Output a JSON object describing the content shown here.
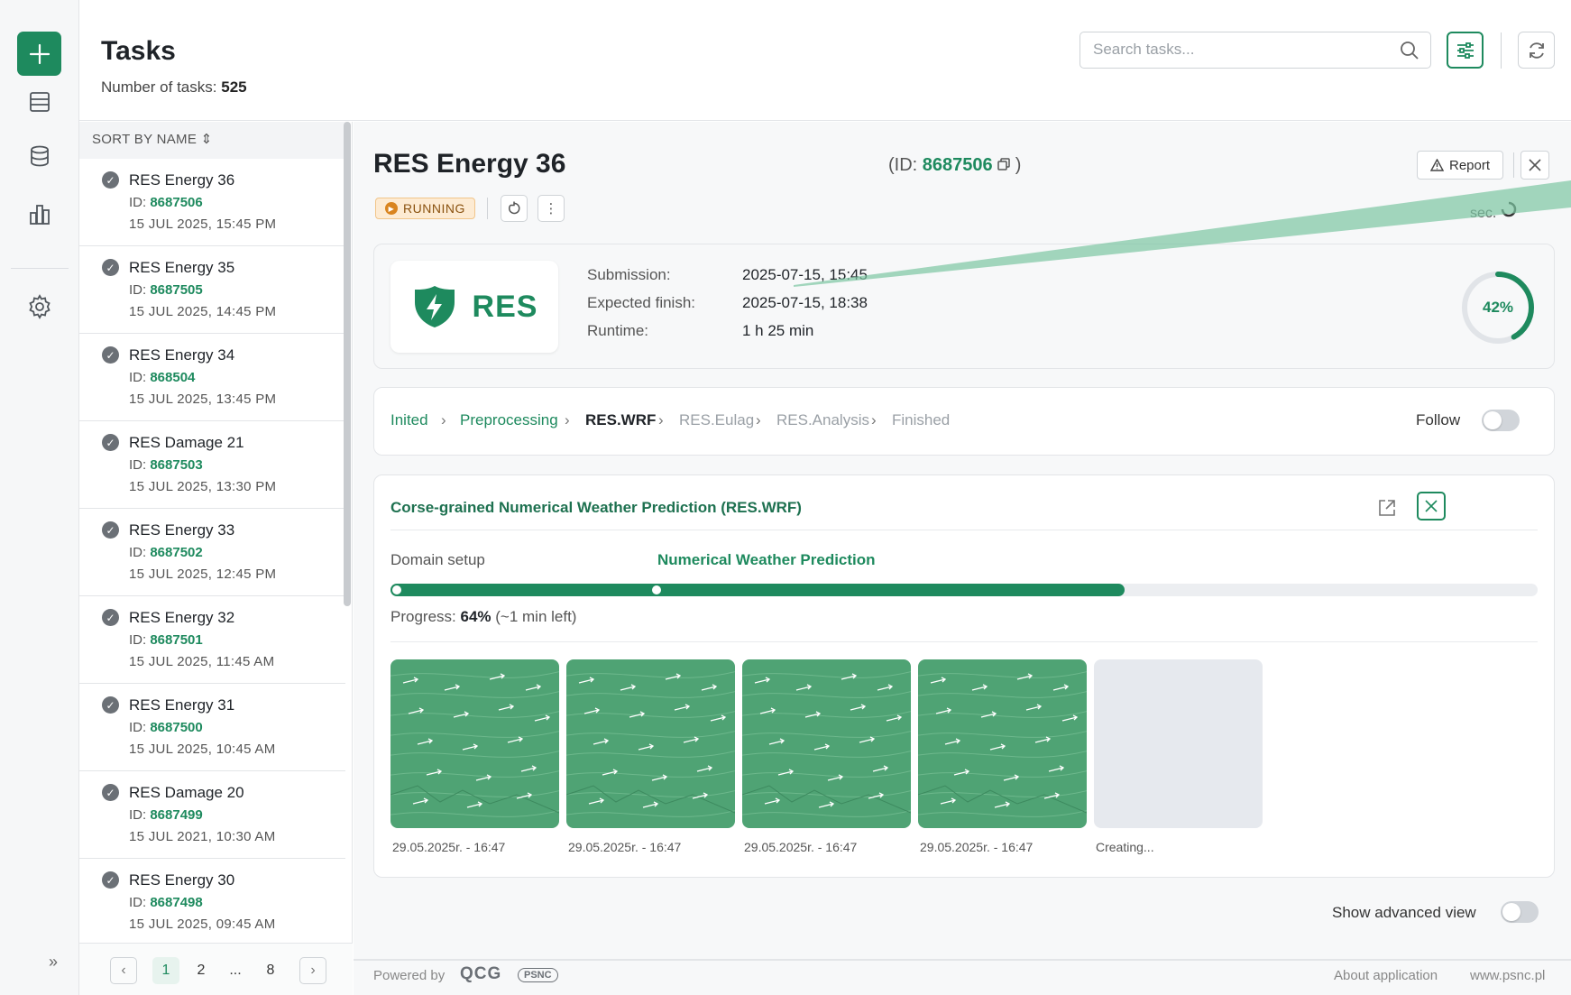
{
  "header": {
    "title": "Tasks",
    "count_label": "Number of tasks:",
    "count_value": "525",
    "search_placeholder": "Search tasks..."
  },
  "sidebar": {
    "icons": [
      "plus-icon",
      "list-icon",
      "database-icon",
      "chart-icon",
      "gear-icon"
    ],
    "collapse": "»"
  },
  "list": {
    "sort_label": "SORT BY NAME",
    "sort_icon": "⇕",
    "id_prefix": "ID:",
    "tasks": [
      {
        "name": "RES Energy 36",
        "id": "8687506",
        "date": "15 JUL 2025, 15:45 PM"
      },
      {
        "name": "RES Energy 35",
        "id": "8687505",
        "date": "15 JUL 2025, 14:45 PM"
      },
      {
        "name": "RES Energy 34",
        "id": "868504",
        "date": "15 JUL 2025, 13:45 PM"
      },
      {
        "name": "RES Damage 21",
        "id": "8687503",
        "date": "15 JUL 2025, 13:30 PM"
      },
      {
        "name": "RES Energy 33",
        "id": "8687502",
        "date": "15 JUL 2025, 12:45 PM"
      },
      {
        "name": "RES Energy 32",
        "id": "8687501",
        "date": "15 JUL 2025, 11:45 AM"
      },
      {
        "name": "RES Energy 31",
        "id": "8687500",
        "date": "15 JUL 2025, 10:45 AM"
      },
      {
        "name": "RES Damage 20",
        "id": "8687499",
        "date": "15 JUL 2021, 10:30 AM"
      },
      {
        "name": "RES Energy 30",
        "id": "8687498",
        "date": "15 JUL 2025, 09:45 AM"
      }
    ],
    "pager": {
      "prev": "‹",
      "pages": [
        "1",
        "2",
        "...",
        "8"
      ],
      "next": "›",
      "active": "1"
    }
  },
  "detail": {
    "title": "RES Energy  36",
    "id_open": "(ID:",
    "id_value": "8687506",
    "id_close": ")",
    "status": "RUNNING",
    "report_label": "Report",
    "partial_text": "sec.",
    "logo_text": "RES",
    "info": [
      {
        "label": "Submission:",
        "value": "2025-07-15, 15:45"
      },
      {
        "label": "Expected finish:",
        "value": "2025-07-15, 18:38"
      },
      {
        "label": "Runtime:",
        "value": "1 h 25 min"
      }
    ],
    "overall_progress": 42,
    "overall_progress_label": "42%",
    "steps": [
      {
        "label": "Inited",
        "state": "done"
      },
      {
        "label": "Preprocessing",
        "state": "done"
      },
      {
        "label": "RES.WRF",
        "state": "current"
      },
      {
        "label": "RES.Eulag",
        "state": "todo"
      },
      {
        "label": "RES.Analysis",
        "state": "todo"
      },
      {
        "label": "Finished",
        "state": "todo"
      }
    ],
    "follow_label": "Follow",
    "follow_on": false,
    "stage": {
      "title": "Corse-grained Numerical Weather Prediction (RES.WRF)",
      "phase_1": "Domain setup",
      "phase_2": "Numerical Weather Prediction",
      "progress": 64,
      "progress_label": "Progress:",
      "progress_value": "64%",
      "progress_left": "(~1 min left)",
      "thumbnails": [
        {
          "label": "29.05.2025r. - 16:47",
          "state": "ready"
        },
        {
          "label": "29.05.2025r. - 16:47",
          "state": "ready"
        },
        {
          "label": "29.05.2025r. - 16:47",
          "state": "ready"
        },
        {
          "label": "29.05.2025r. - 16:47",
          "state": "ready"
        },
        {
          "label": "Creating...",
          "state": "pending"
        }
      ]
    },
    "advanced_label": "Show advanced view",
    "advanced_on": false
  },
  "footer": {
    "powered": "Powered by",
    "qcg": "QCG",
    "psnc": "PSNC",
    "about": "About application",
    "www": "www.psnc.pl"
  },
  "colors": {
    "accent": "#1e8a5e",
    "running": "#d9841f",
    "muted": "#9aa0a6"
  }
}
